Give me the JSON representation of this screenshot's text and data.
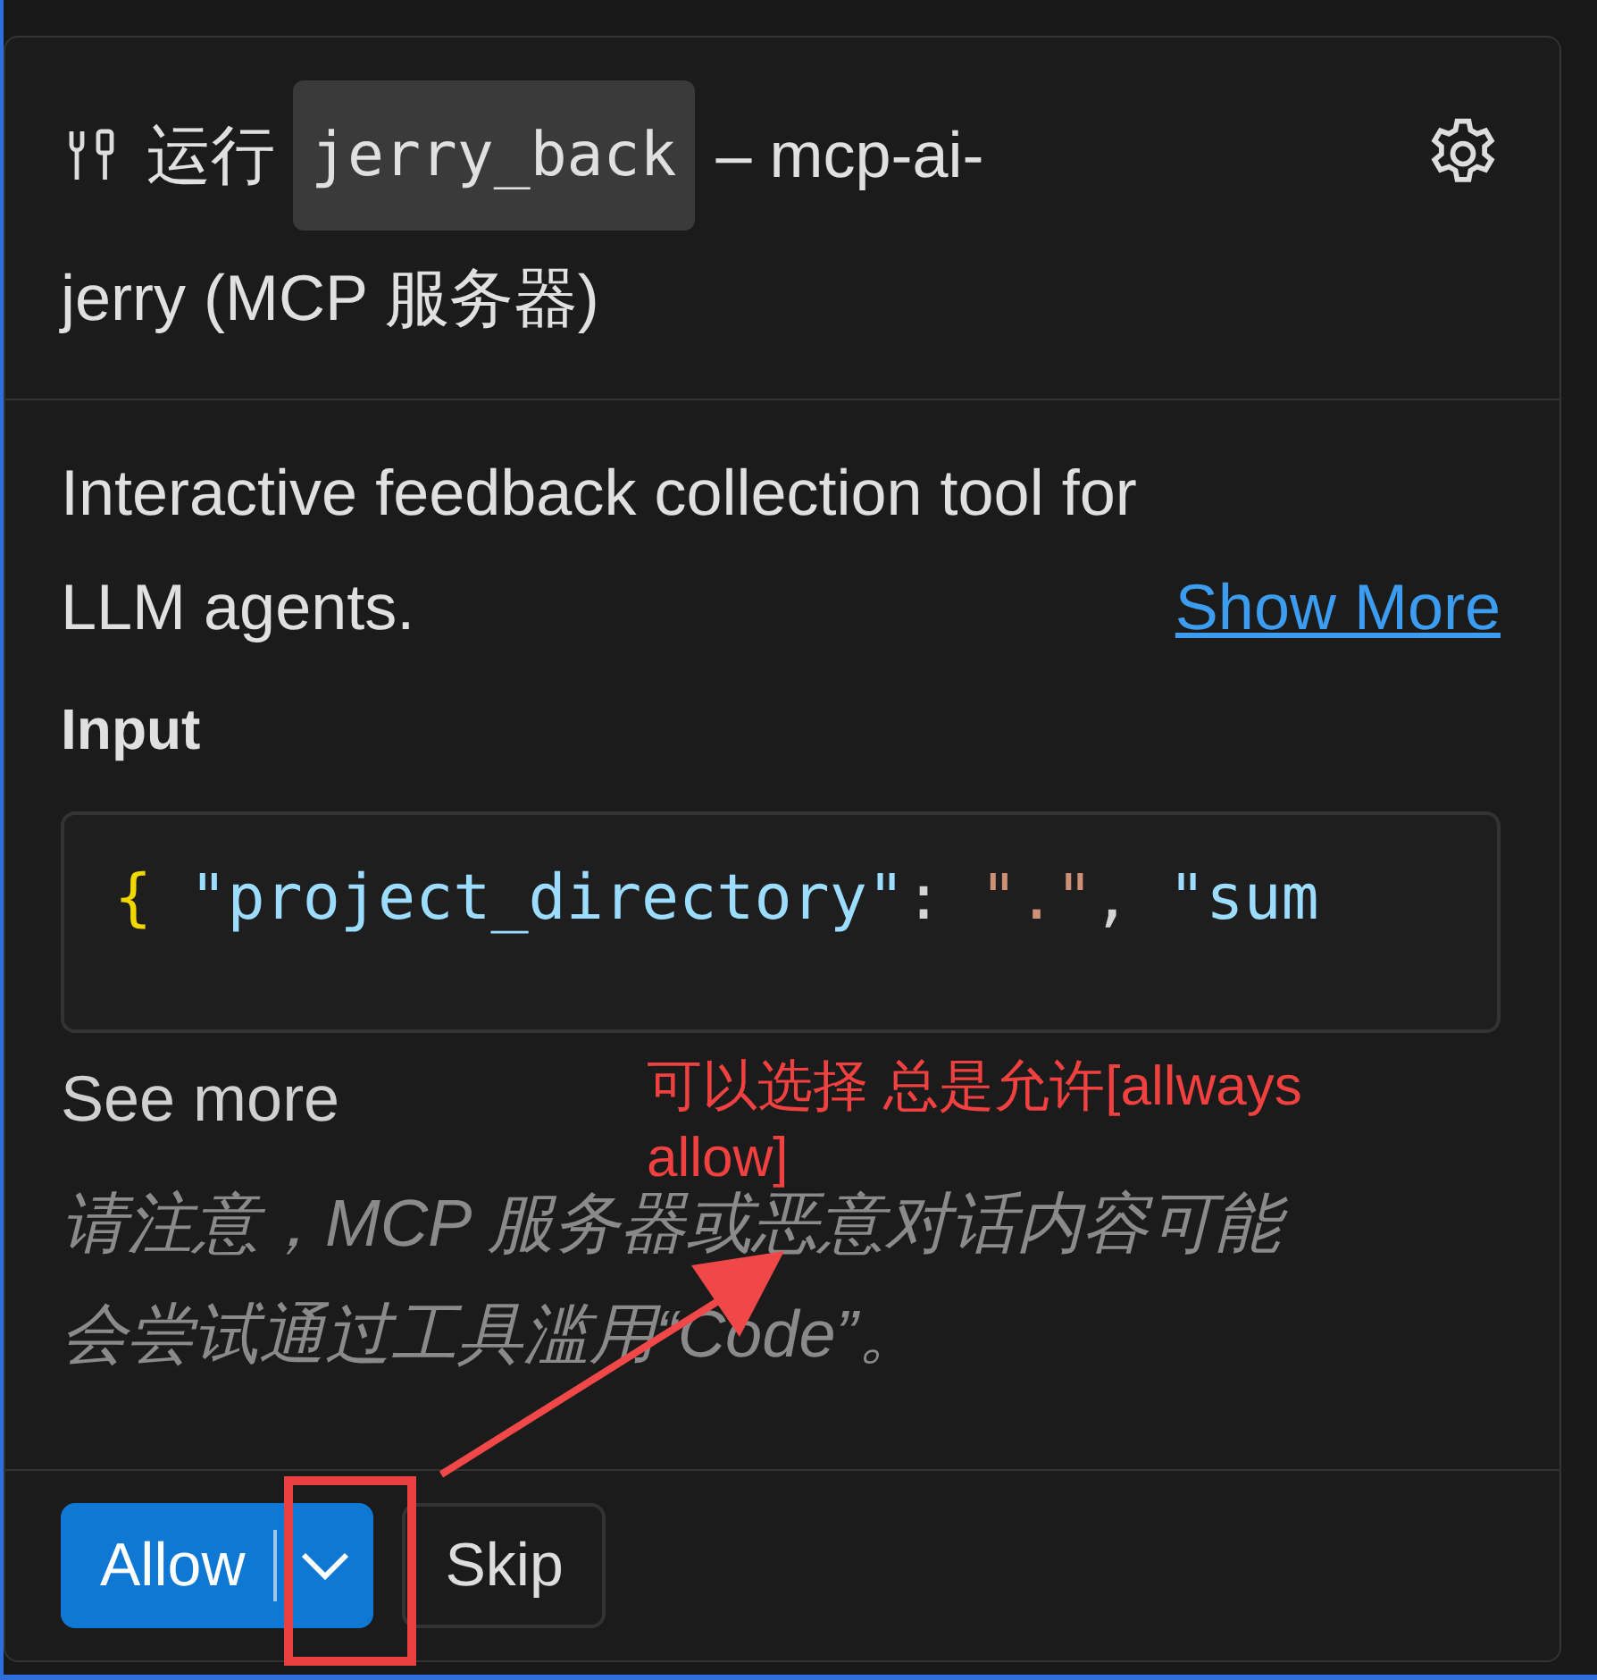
{
  "header": {
    "run_label": "运行",
    "tool_name": "jerry_back",
    "server_text_lines": [
      "– mcp-ai-",
      "jerry (MCP 服务器)"
    ]
  },
  "description": {
    "lines": [
      "Interactive feedback collection tool for",
      "LLM agents."
    ],
    "link": "Show More"
  },
  "input": {
    "label": "Input",
    "code_tokens": [
      {
        "kind": "brace",
        "text": "{"
      },
      {
        "kind": "key",
        "text": " \"project_directory\""
      },
      {
        "kind": "punct",
        "text": ": "
      },
      {
        "kind": "string",
        "text": "\".\""
      },
      {
        "kind": "punct",
        "text": ", "
      },
      {
        "kind": "key",
        "text": "\"sum"
      }
    ],
    "see_more": "See more"
  },
  "warning_lines": [
    "请注意，MCP 服务器或恶意对话内容可能",
    "会尝试通过工具滥用“Code”。"
  ],
  "buttons": [
    {
      "kind": "split",
      "label": "Allow"
    },
    {
      "kind": "plain",
      "label": "Skip"
    }
  ],
  "annotation": {
    "text": "可以选择 总是允许[allways allow]"
  }
}
